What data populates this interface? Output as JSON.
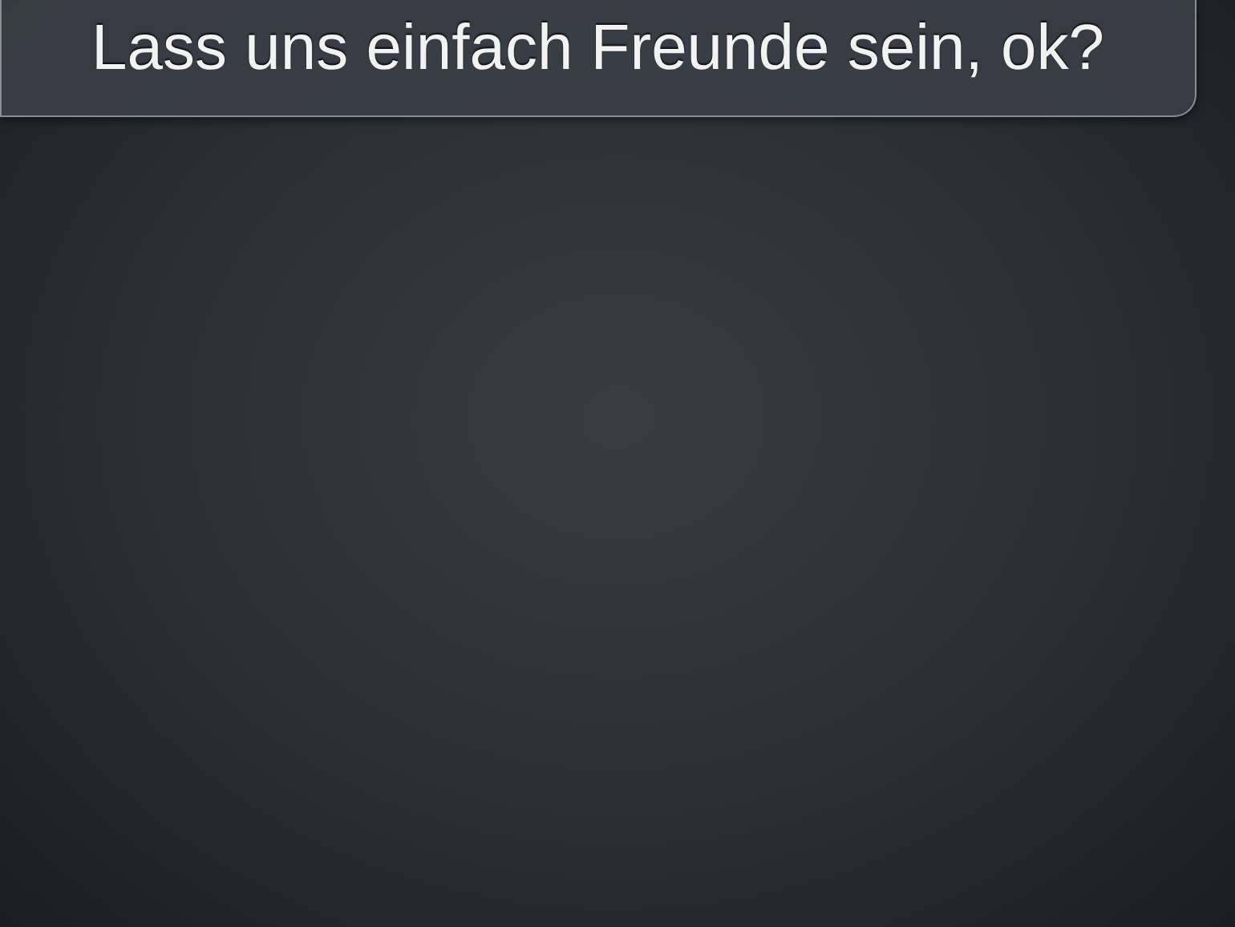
{
  "bubble": {
    "text": "Lass uns einfach Freunde sein, ok?"
  }
}
